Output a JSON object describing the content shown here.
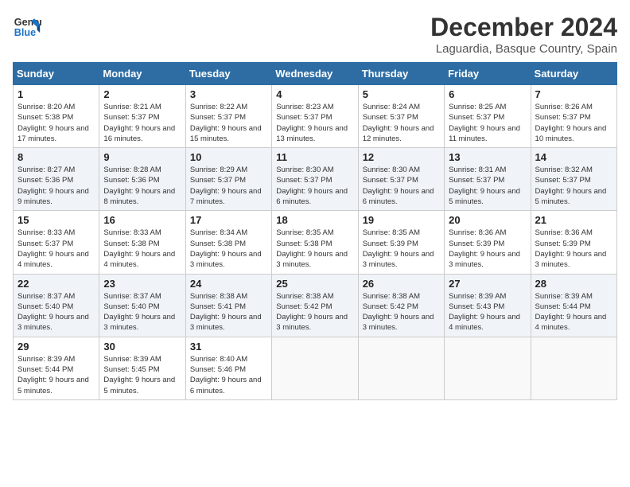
{
  "header": {
    "logo_line1": "General",
    "logo_line2": "Blue",
    "month": "December 2024",
    "location": "Laguardia, Basque Country, Spain"
  },
  "days_of_week": [
    "Sunday",
    "Monday",
    "Tuesday",
    "Wednesday",
    "Thursday",
    "Friday",
    "Saturday"
  ],
  "weeks": [
    [
      {
        "day": "1",
        "sunrise": "8:20 AM",
        "sunset": "5:38 PM",
        "daylight": "9 hours and 17 minutes."
      },
      {
        "day": "2",
        "sunrise": "8:21 AM",
        "sunset": "5:37 PM",
        "daylight": "9 hours and 16 minutes."
      },
      {
        "day": "3",
        "sunrise": "8:22 AM",
        "sunset": "5:37 PM",
        "daylight": "9 hours and 15 minutes."
      },
      {
        "day": "4",
        "sunrise": "8:23 AM",
        "sunset": "5:37 PM",
        "daylight": "9 hours and 13 minutes."
      },
      {
        "day": "5",
        "sunrise": "8:24 AM",
        "sunset": "5:37 PM",
        "daylight": "9 hours and 12 minutes."
      },
      {
        "day": "6",
        "sunrise": "8:25 AM",
        "sunset": "5:37 PM",
        "daylight": "9 hours and 11 minutes."
      },
      {
        "day": "7",
        "sunrise": "8:26 AM",
        "sunset": "5:37 PM",
        "daylight": "9 hours and 10 minutes."
      }
    ],
    [
      {
        "day": "8",
        "sunrise": "8:27 AM",
        "sunset": "5:36 PM",
        "daylight": "9 hours and 9 minutes."
      },
      {
        "day": "9",
        "sunrise": "8:28 AM",
        "sunset": "5:36 PM",
        "daylight": "9 hours and 8 minutes."
      },
      {
        "day": "10",
        "sunrise": "8:29 AM",
        "sunset": "5:37 PM",
        "daylight": "9 hours and 7 minutes."
      },
      {
        "day": "11",
        "sunrise": "8:30 AM",
        "sunset": "5:37 PM",
        "daylight": "9 hours and 6 minutes."
      },
      {
        "day": "12",
        "sunrise": "8:30 AM",
        "sunset": "5:37 PM",
        "daylight": "9 hours and 6 minutes."
      },
      {
        "day": "13",
        "sunrise": "8:31 AM",
        "sunset": "5:37 PM",
        "daylight": "9 hours and 5 minutes."
      },
      {
        "day": "14",
        "sunrise": "8:32 AM",
        "sunset": "5:37 PM",
        "daylight": "9 hours and 5 minutes."
      }
    ],
    [
      {
        "day": "15",
        "sunrise": "8:33 AM",
        "sunset": "5:37 PM",
        "daylight": "9 hours and 4 minutes."
      },
      {
        "day": "16",
        "sunrise": "8:33 AM",
        "sunset": "5:38 PM",
        "daylight": "9 hours and 4 minutes."
      },
      {
        "day": "17",
        "sunrise": "8:34 AM",
        "sunset": "5:38 PM",
        "daylight": "9 hours and 3 minutes."
      },
      {
        "day": "18",
        "sunrise": "8:35 AM",
        "sunset": "5:38 PM",
        "daylight": "9 hours and 3 minutes."
      },
      {
        "day": "19",
        "sunrise": "8:35 AM",
        "sunset": "5:39 PM",
        "daylight": "9 hours and 3 minutes."
      },
      {
        "day": "20",
        "sunrise": "8:36 AM",
        "sunset": "5:39 PM",
        "daylight": "9 hours and 3 minutes."
      },
      {
        "day": "21",
        "sunrise": "8:36 AM",
        "sunset": "5:39 PM",
        "daylight": "9 hours and 3 minutes."
      }
    ],
    [
      {
        "day": "22",
        "sunrise": "8:37 AM",
        "sunset": "5:40 PM",
        "daylight": "9 hours and 3 minutes."
      },
      {
        "day": "23",
        "sunrise": "8:37 AM",
        "sunset": "5:40 PM",
        "daylight": "9 hours and 3 minutes."
      },
      {
        "day": "24",
        "sunrise": "8:38 AM",
        "sunset": "5:41 PM",
        "daylight": "9 hours and 3 minutes."
      },
      {
        "day": "25",
        "sunrise": "8:38 AM",
        "sunset": "5:42 PM",
        "daylight": "9 hours and 3 minutes."
      },
      {
        "day": "26",
        "sunrise": "8:38 AM",
        "sunset": "5:42 PM",
        "daylight": "9 hours and 3 minutes."
      },
      {
        "day": "27",
        "sunrise": "8:39 AM",
        "sunset": "5:43 PM",
        "daylight": "9 hours and 4 minutes."
      },
      {
        "day": "28",
        "sunrise": "8:39 AM",
        "sunset": "5:44 PM",
        "daylight": "9 hours and 4 minutes."
      }
    ],
    [
      {
        "day": "29",
        "sunrise": "8:39 AM",
        "sunset": "5:44 PM",
        "daylight": "9 hours and 5 minutes."
      },
      {
        "day": "30",
        "sunrise": "8:39 AM",
        "sunset": "5:45 PM",
        "daylight": "9 hours and 5 minutes."
      },
      {
        "day": "31",
        "sunrise": "8:40 AM",
        "sunset": "5:46 PM",
        "daylight": "9 hours and 6 minutes."
      },
      null,
      null,
      null,
      null
    ]
  ]
}
